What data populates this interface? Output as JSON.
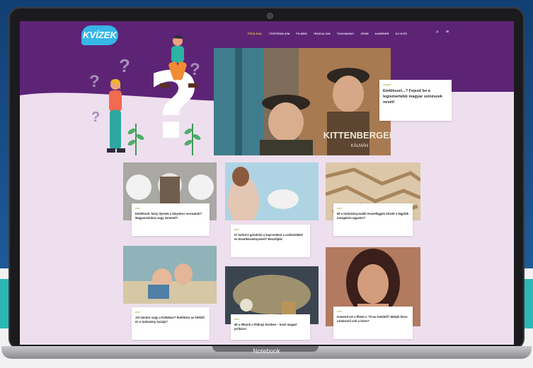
{
  "device_label": "Notebook",
  "site": {
    "logo_text": "KVÍZEK",
    "nav": [
      "FŐOLDAL",
      "TÖRTÉNELEM",
      "FILMEK",
      "IRODALOM",
      "TUDOMÁNY",
      "ZENE",
      "KARRIER",
      "ÚJ KVÍZ"
    ],
    "nav_active_index": 0,
    "search_icon": "search-icon",
    "menu_icon": "menu-icon"
  },
  "hero": {
    "image_text": "KITTENBERGER",
    "image_subtext": "KÁLMÁN",
    "tag": "FILMEK",
    "title": "Emlékszel...? Fejezd be a legismertebb magyar színészek nevét!"
  },
  "cards": [
    {
      "tag": "KVÍZ",
      "title": "Emlékszel, hány ilyenek a lányokos sorozatok? Magyarszinhaz vagy ismered?"
    },
    {
      "tag": "KVÍZ",
      "title": "Ki tudod-e gondolni a kapcsolatot a szóközökkel és következményeivel? Beszéljük!"
    },
    {
      "tag": "KVÍZ",
      "title": "Mi a tudományosabb összefüggés között a legjobb mozgalom ugyanis?"
    },
    {
      "tag": "KVÍZ",
      "title": "Jól tanulsz vagy a fizikában? Emlékezz az életből és a tudomány hazája?"
    },
    {
      "tag": "KVÍZ",
      "title": "Mi a titkunk a földrajz kvízben – teszt magad próbára!"
    },
    {
      "tag": "KVÍZ",
      "title": "Ismered ezt a filmet a '70-es évekből? Melyik híres színésznő volt a híres?"
    }
  ],
  "colors": {
    "header_purple": "#5d2476",
    "page_bg": "#eedfee",
    "accent_yellow": "#ffd040",
    "logo_blue": "#35b6e6",
    "tag_green": "#9ab83a"
  }
}
